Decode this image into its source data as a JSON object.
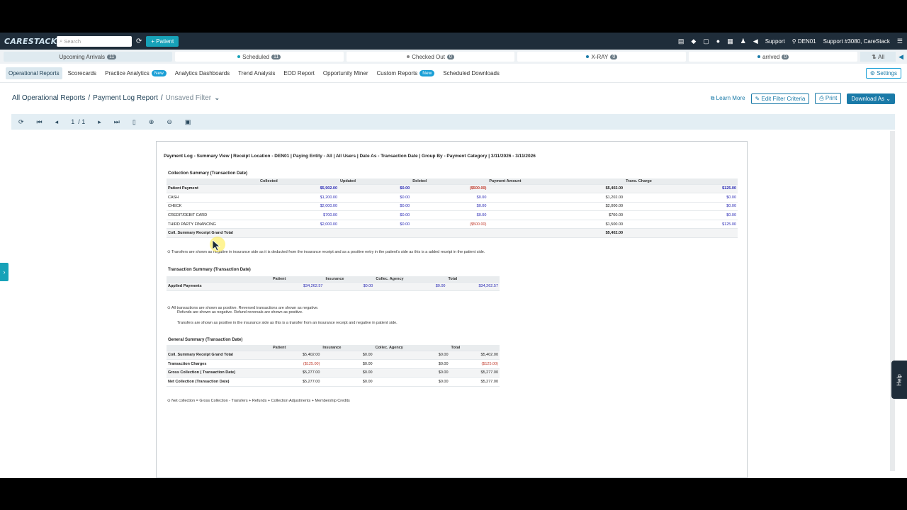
{
  "app": {
    "logo": "CARESTACK",
    "search_placeholder": "Search",
    "patient_button": "+ Patient",
    "support": "Support",
    "location": "DEN01",
    "user": "Support #3080, CareStack"
  },
  "statusbar": [
    {
      "label": "Upcoming Arrivals",
      "count": "11"
    },
    {
      "label": "Scheduled",
      "count": "11",
      "dot": "#17a2b8"
    },
    {
      "label": "Checked Out",
      "count": "0",
      "dot": "#888888"
    },
    {
      "label": "X-RAY",
      "count": "0",
      "dot": "#1a7aa8"
    },
    {
      "label": "arrived",
      "count": "0",
      "dot": "#1a7aa8"
    }
  ],
  "statusbar_all": "All",
  "nav": {
    "items": [
      "Operational Reports",
      "Scorecards",
      "Practice Analytics",
      "Analytics Dashboards",
      "Trend Analysis",
      "EOD Report",
      "Opportunity Miner",
      "Custom Reports",
      "Scheduled Downloads"
    ],
    "new_badge": "New",
    "settings": "Settings"
  },
  "breadcrumb": {
    "root": "All Operational Reports",
    "report": "Payment Log Report",
    "filter": "Unsaved Filter"
  },
  "actions": {
    "learn": "Learn More",
    "edit": "Edit Filter Criteria",
    "print": "Print",
    "download": "Download As"
  },
  "toolbar": {
    "page": "1",
    "of": "/ 1"
  },
  "report": {
    "title": "Payment Log - Summary View | Receipt Location - DEN01 | Paying Entity - All | All Users | Date As - Transaction Date | Group By - Payment Category | 3/11/2026 - 3/11/2026",
    "collection": {
      "title": "Collection Summary (Transaction Date)",
      "headers": [
        "",
        "Collected",
        "Updated",
        "Deleted",
        "Payment Amount",
        "Trans. Charge"
      ],
      "rows": [
        [
          "Patient Payment",
          "$5,902.00",
          "$0.00",
          "($500.00)",
          "$5,402.00",
          "$125.00"
        ],
        [
          "CASH",
          "$1,200.00",
          "$0.00",
          "$0.00",
          "$1,202.00",
          "$0.00"
        ],
        [
          "CHECK",
          "$2,000.00",
          "$0.00",
          "$0.00",
          "$2,000.00",
          "$0.00"
        ],
        [
          "CREDIT/DEBIT CARD",
          "$700.00",
          "$0.00",
          "$0.00",
          "$700.00",
          "$0.00"
        ],
        [
          "THIRD PARTY FINANCING",
          "$2,000.00",
          "$0.00",
          "($500.00)",
          "$1,500.00",
          "$125.00"
        ],
        [
          "Coll. Summary Receipt Grand Total",
          "",
          "",
          "",
          "$5,402.00",
          ""
        ]
      ],
      "note": "Transfers are shown as negative in insurance side as it is deducted from the insurance receipt and as a positive entry in the patient's side as this is a added receipt in the patient side."
    },
    "transaction": {
      "title": "Transaction Summary (Transaction Date)",
      "headers": [
        "",
        "Patient",
        "Insurance",
        "Collec. Agency",
        "Total"
      ],
      "rows": [
        [
          "Applied Payments",
          "$34,262.57",
          "$0.00",
          "$0.00",
          "$34,262.57"
        ]
      ],
      "note1": "All transactions are shown as positive. Reversed transactions are shown as negative.",
      "note2": "Refunds are shown as negative. Refund reversals are shown as positive.",
      "note3": "Transfers are shown as positive in the insurance side as this is a transfer from an insurance receipt and negative in patient side."
    },
    "general": {
      "title": "General Summary (Transaction Date)",
      "headers": [
        "",
        "Patient",
        "Insurance",
        "Collec. Agency",
        "Total"
      ],
      "rows": [
        [
          "Coll. Summary Receipt Grand Total",
          "$5,402.00",
          "$0.00",
          "$0.00",
          "$5,402.00"
        ],
        [
          "Transaction Charges",
          "($125.00)",
          "$0.00",
          "$0.00",
          "($125.00)"
        ],
        [
          "Gross Collection ( Transaction Date)",
          "$5,277.00",
          "$0.00",
          "$0.00",
          "$5,277.00"
        ],
        [
          "Net Collection (Transaction Date)",
          "$5,277.00",
          "$0.00",
          "$0.00",
          "$5,277.00"
        ]
      ],
      "note": "Net collection = Gross Collection - Transfers + Refunds + Collection Adjustments + Membership Credits"
    }
  },
  "help": "Help"
}
